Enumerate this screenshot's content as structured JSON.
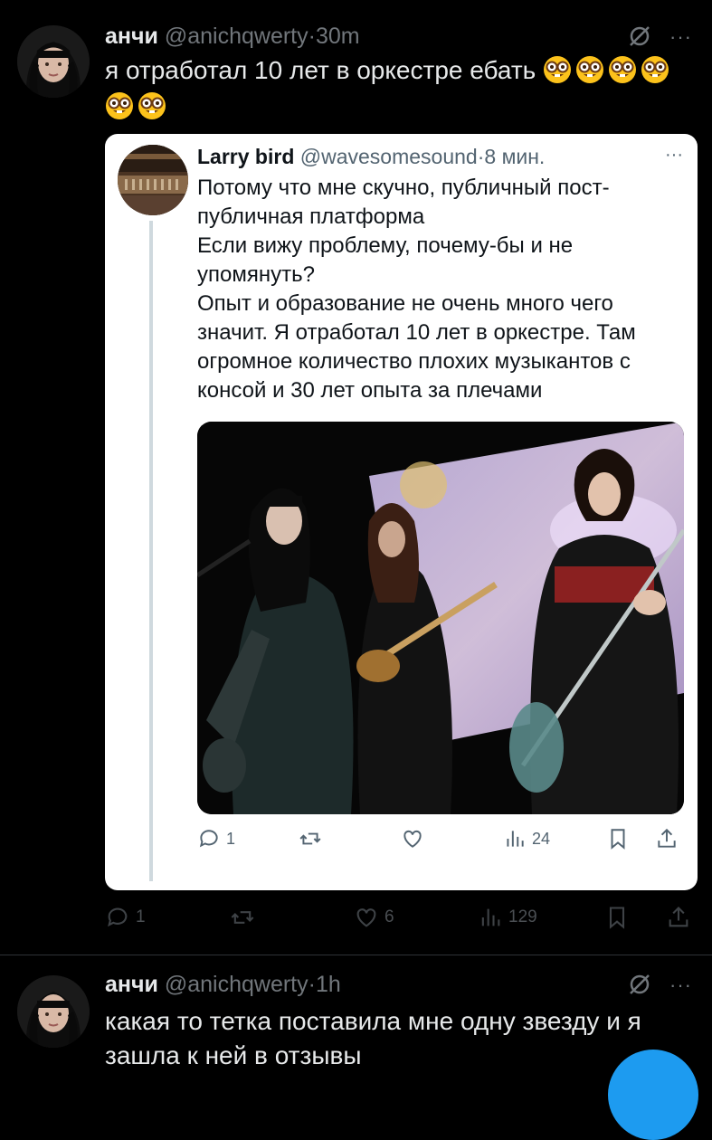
{
  "tweet1": {
    "name": "анчи",
    "handle": "@anichqwerty",
    "dot": "·",
    "time": "30m",
    "text": "я отработал 10 лет в оркестре ебать",
    "emoji": "nerd-face-icon",
    "emoji_count": 6,
    "more": "···",
    "replies": "1",
    "likes": "6",
    "views": "129"
  },
  "quote": {
    "name": "Larry bird",
    "handle": "@wavesomesound",
    "dot": "·",
    "time": "8 мин.",
    "more": "···",
    "text": "Потому что мне скучно, публичный пост-\nпубличная платформа\nЕсли вижу проблему, почему-бы и не\nупомянуть?\nОпыт и образование не очень много чего\nзначит. Я отработал 10 лет в оркестре. Там\nогромное количество плохих музыкантов с\nконсой и 30 лет опыта за плечами",
    "replies": "1",
    "views": "24",
    "photo": "band-performing-on-stage-photo"
  },
  "tweet2": {
    "name": "анчи",
    "handle": "@anichqwerty",
    "dot": "·",
    "time": "1h",
    "more": "···",
    "text": "какая то тетка поставила мне одну звезду и я зашла к ней в отзывы"
  },
  "colors": {
    "background": "#000000",
    "text": "#e7e9ea",
    "muted": "#71767b",
    "accent": "#1d9bf0",
    "card": "#ffffff"
  }
}
